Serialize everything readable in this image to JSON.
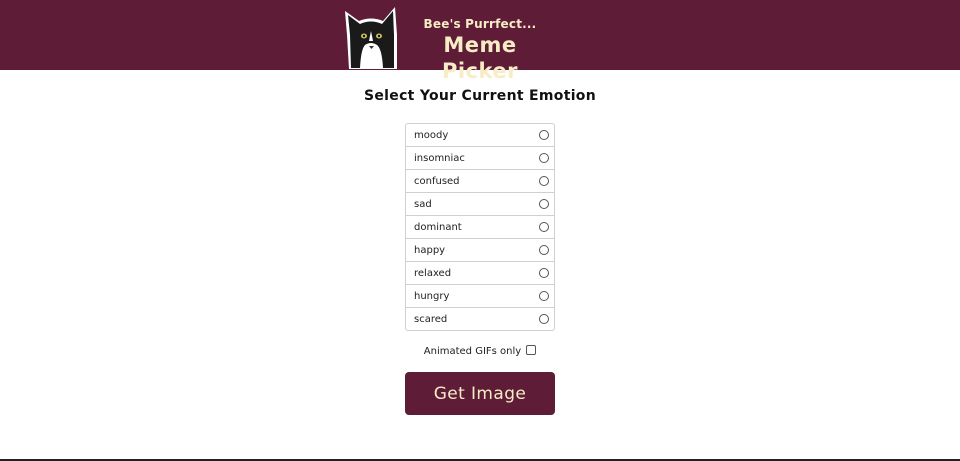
{
  "header": {
    "subtitle": "Bee's Purrfect...",
    "title": "Meme Picker",
    "background_color": "#5f1c36",
    "text_color": "#f6edc6"
  },
  "main": {
    "heading": "Select Your Current Emotion",
    "emotions": [
      {
        "label": "moody",
        "selected": false
      },
      {
        "label": "insomniac",
        "selected": false
      },
      {
        "label": "confused",
        "selected": false
      },
      {
        "label": "sad",
        "selected": false
      },
      {
        "label": "dominant",
        "selected": false
      },
      {
        "label": "happy",
        "selected": false
      },
      {
        "label": "relaxed",
        "selected": false
      },
      {
        "label": "hungry",
        "selected": false
      },
      {
        "label": "scared",
        "selected": false
      }
    ],
    "gif_label": "Animated GIFs only",
    "gif_checked": false,
    "button_label": "Get Image"
  }
}
